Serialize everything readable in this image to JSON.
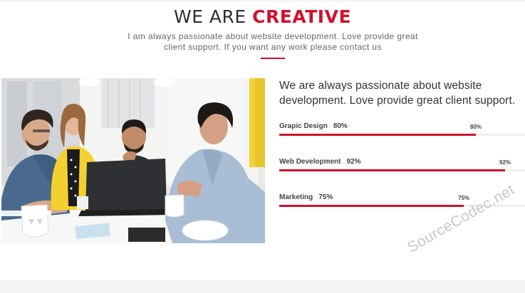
{
  "section": {
    "heading_prefix": "WE ARE",
    "heading_accent": "CREATIVE",
    "intro": "I am always passionate about website development. Love provide great client support. If you want any work please contact us"
  },
  "about": {
    "lead": "We are always passionate about website development. Love provide great client support."
  },
  "skills": [
    {
      "name": "Grapic Design",
      "percent_label": "80%",
      "value": 80
    },
    {
      "name": "Web Development",
      "percent_label": "92%",
      "value": 92
    },
    {
      "name": "Marketing",
      "percent_label": "75%",
      "value": 75
    }
  ],
  "colors": {
    "accent": "#d0122d",
    "track": "#eeeeee",
    "heading": "#2f2f2f"
  },
  "watermark": "SourceCodec.net"
}
